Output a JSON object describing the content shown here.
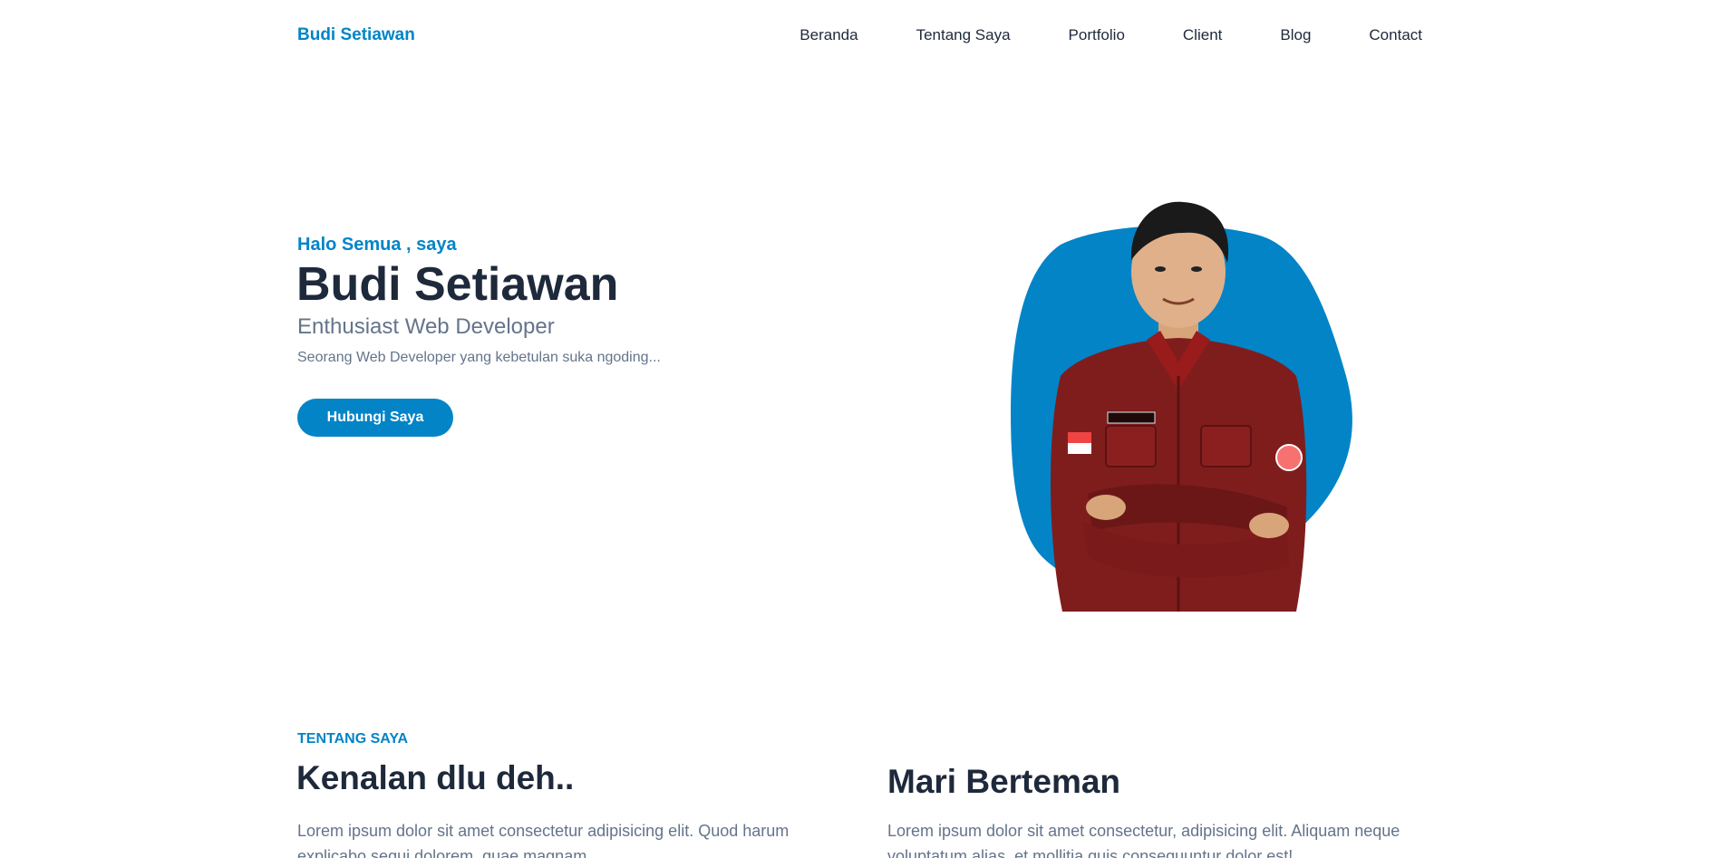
{
  "header": {
    "brand": "Budi Setiawan",
    "nav": [
      "Beranda",
      "Tentang Saya",
      "Portfolio",
      "Client",
      "Blog",
      "Contact"
    ]
  },
  "hero": {
    "greeting": "Halo Semua , saya",
    "name": "Budi Setiawan",
    "role": "Enthusiast Web Developer",
    "description": "Seorang Web Developer yang kebetulan suka ngoding...",
    "cta_label": "Hubungi Saya",
    "photo": {
      "blob_color": "#0284c7",
      "shirt_color": "#7f1d1d",
      "name_tag": "BUDI SETIAWAN",
      "badge": "BEM FT"
    }
  },
  "about": {
    "eyebrow": "TENTANG SAYA",
    "title": "Kenalan dlu deh..",
    "text": "Lorem ipsum dolor sit amet consectetur adipisicing elit. Quod harum explicabo sequi dolorem, quae magnam.",
    "friend_title": "Mari Berteman",
    "friend_text": "Lorem ipsum dolor sit amet consectetur, adipisicing elit. Aliquam neque voluptatum alias, et mollitia quis consequuntur dolor est!"
  },
  "colors": {
    "accent": "#0284c7",
    "heading": "#1e293b",
    "muted": "#64748b"
  }
}
